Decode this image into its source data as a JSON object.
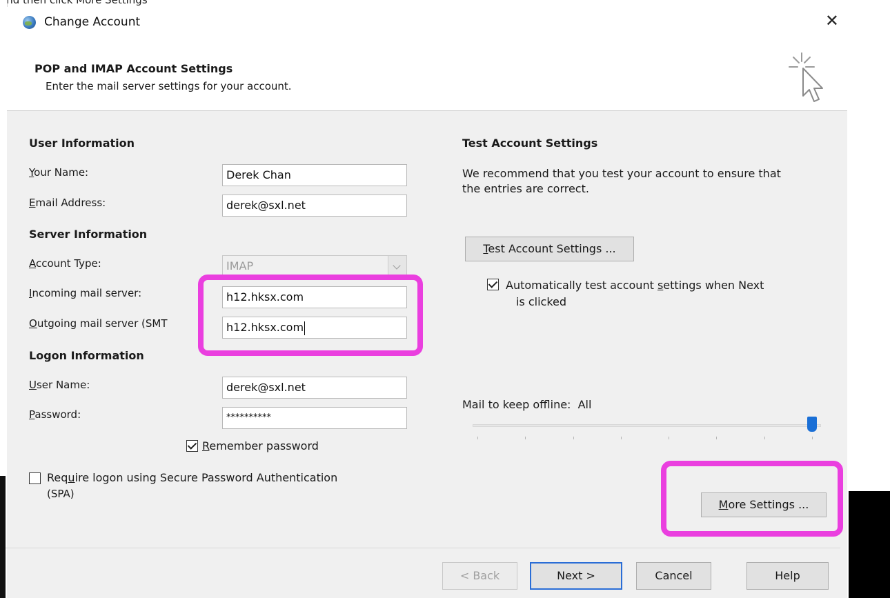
{
  "caption": "and then click More Settings",
  "window": {
    "title": "Change Account",
    "close_glyph": "✕"
  },
  "header": {
    "title": "POP and IMAP Account Settings",
    "subtitle": "Enter the mail server settings for your account."
  },
  "user_info": {
    "section": "User Information",
    "name_label_u": "Y",
    "name_label_rest": "our Name:",
    "name_value": "Derek Chan",
    "email_label_u": "E",
    "email_label_rest": "mail Address:",
    "email_value": "derek@sxl.net"
  },
  "server_info": {
    "section": "Server Information",
    "account_type_label_u": "A",
    "account_type_label_rest": "ccount Type:",
    "account_type_value": "IMAP",
    "incoming_label_u": "I",
    "incoming_label_rest": "ncoming mail server:",
    "incoming_value": "h12.hksx.com",
    "outgoing_label_u": "O",
    "outgoing_label_rest": "utgoing mail server (SMT",
    "outgoing_value": "h12.hksx.com"
  },
  "logon_info": {
    "section": "Logon Information",
    "user_label_u": "U",
    "user_label_rest": "ser Name:",
    "user_value": "derek@sxl.net",
    "password_label_u": "P",
    "password_label_rest": "assword:",
    "password_value": "**********",
    "remember_u": "R",
    "remember_rest": "emember password",
    "remember_checked": true,
    "spa_pre": "Req",
    "spa_u": "u",
    "spa_rest": "ire logon using Secure Password Authentication",
    "spa_line2": "(SPA)",
    "spa_checked": false
  },
  "test_settings": {
    "section": "Test Account Settings",
    "desc_line1": "We recommend that you test your account to ensure that",
    "desc_line2": "the entries are correct.",
    "button_u": "T",
    "button_rest": "est Account Settings ...",
    "auto_pre": "Automatically test account ",
    "auto_u": "s",
    "auto_rest": "ettings when Next",
    "auto_line2": "is clicked",
    "auto_checked": true
  },
  "offline": {
    "label": "Mail to keep offline:",
    "value": "All",
    "slider_position_fraction": 1.0,
    "tick_count": 8
  },
  "more_settings": {
    "u": "M",
    "rest": "ore Settings ..."
  },
  "footer": {
    "back": "< Back",
    "next": "Next >",
    "cancel": "Cancel",
    "help": "Help"
  },
  "colors": {
    "highlight": "#ea3fdf",
    "slider_thumb": "#1a6fd6",
    "default_button_border": "#2a6dd6"
  }
}
